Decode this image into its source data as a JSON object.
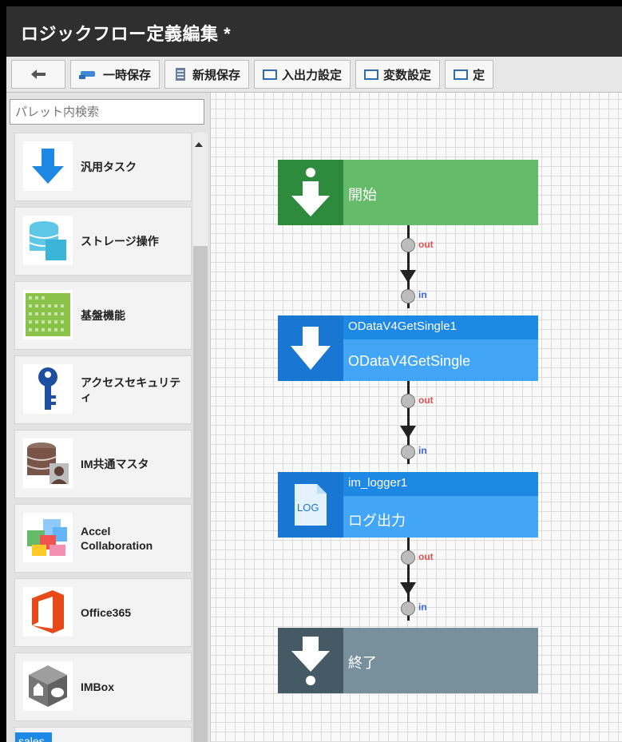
{
  "window": {
    "title": "ロジックフロー定義編集 *"
  },
  "toolbar": {
    "back_icon": "arrow-left-icon",
    "buttons": [
      {
        "label": "一時保存",
        "icon": "temp-save-icon"
      },
      {
        "label": "新規保存",
        "icon": "new-save-icon"
      },
      {
        "label": "入出力設定",
        "icon": "box-icon"
      },
      {
        "label": "変数設定",
        "icon": "box-icon"
      },
      {
        "label": "定",
        "icon": "box-icon"
      }
    ]
  },
  "palette": {
    "search_placeholder": "パレット内検索",
    "items": [
      {
        "label": "汎用タスク",
        "icon": "arrow-down-icon"
      },
      {
        "label": "ストレージ操作",
        "icon": "database-icon"
      },
      {
        "label": "基盤機能",
        "icon": "grid-icon"
      },
      {
        "label": "アクセスセキュリティ",
        "icon": "key-icon"
      },
      {
        "label": "IM共通マスタ",
        "icon": "database-person-icon"
      },
      {
        "label": "Accel Collaboration",
        "icon": "collaboration-icon"
      },
      {
        "label": "Office365",
        "icon": "office-icon"
      },
      {
        "label": "IMBox",
        "icon": "box-3d-icon"
      },
      {
        "label": "sales",
        "icon": "salesforce-icon"
      }
    ]
  },
  "flow": {
    "start": {
      "label": "開始"
    },
    "odata": {
      "id": "ODataV4GetSingle1",
      "name": "ODataV4GetSingle"
    },
    "logger": {
      "id": "im_logger1",
      "name": "ログ出力",
      "icon_text": "LOG"
    },
    "end": {
      "label": "終了"
    },
    "ports": {
      "out": "out",
      "in": "in"
    }
  },
  "colors": {
    "start_dark": "#2e8b3d",
    "start_light": "#66bb6a",
    "task_dark": "#1976d2",
    "task_mid": "#1e88e5",
    "task_light": "#42a5f5",
    "end_dark": "#455a64",
    "end_light": "#78909c"
  }
}
